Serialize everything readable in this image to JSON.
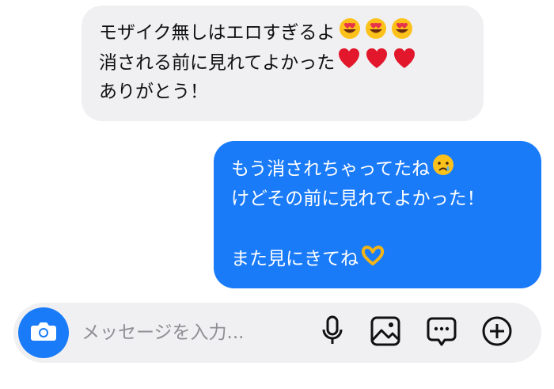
{
  "messages": {
    "received": {
      "lines": [
        "モザイク無しはエロすぎるよ",
        "消される前に見れてよかった",
        "ありがとう！"
      ]
    },
    "sent": {
      "lines": [
        "もう消されちゃってたね",
        "けどその前に見れてよかった！",
        "",
        "また見にきてね"
      ]
    }
  },
  "composer": {
    "placeholder": "メッセージを入力..."
  },
  "icons": {
    "camera": "camera-icon",
    "microphone": "microphone-icon",
    "gallery": "image-icon",
    "sticker": "chat-bubble-icon",
    "add": "plus-circle-icon"
  },
  "colors": {
    "sent_bubble": "#1a7bf9",
    "received_bubble": "#f0f0f2",
    "composer_bg": "#f0f0f2",
    "placeholder": "#8e8e93"
  }
}
